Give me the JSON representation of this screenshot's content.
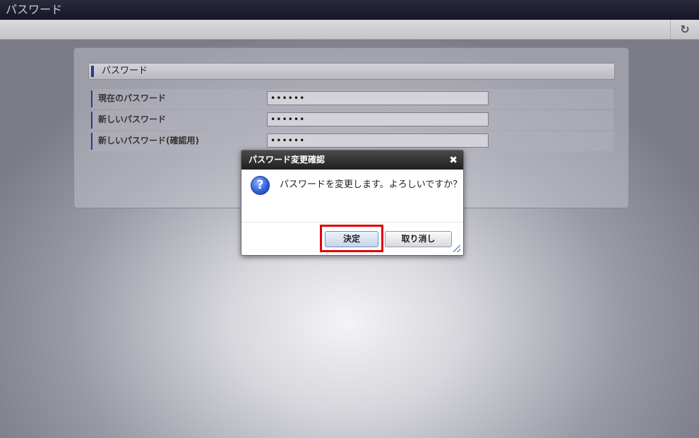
{
  "window": {
    "title": "パスワード"
  },
  "toolbar": {
    "refresh_icon": "refresh-icon",
    "refresh_glyph": "↻"
  },
  "section": {
    "title": "パスワード"
  },
  "form": {
    "rows": [
      {
        "label": "現在のパスワード",
        "value": "••••••"
      },
      {
        "label": "新しいパスワード",
        "value": "••••••"
      },
      {
        "label": "新しいパスワード(確認用)",
        "value": "••••••"
      }
    ]
  },
  "dialog": {
    "title": "パスワード変更確認",
    "close_glyph": "✖",
    "icon_glyph": "?",
    "message": "パスワードを変更します。よろしいですか？",
    "ok_label": "決定",
    "cancel_label": "取り消し"
  },
  "colors": {
    "highlight": "#e00000",
    "accent_bar": "#2c3a8c"
  }
}
